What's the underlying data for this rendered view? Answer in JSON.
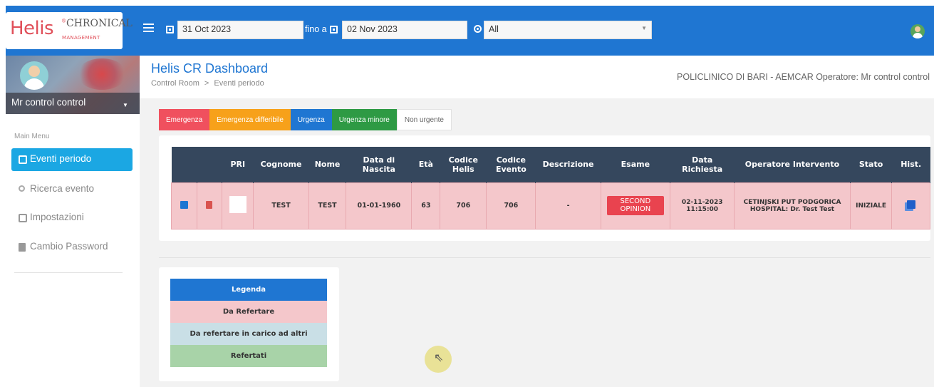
{
  "logo": {
    "helis": "Helis",
    "reg": "®",
    "chronical": "CHRONICAL",
    "management": "MANAGEMENT"
  },
  "topbar": {
    "date_from": "31 Oct 2023",
    "date_to_label": "fino a",
    "date_to": "02 Nov 2023",
    "filter_value": "All"
  },
  "sidebar": {
    "user_name": "Mr control control",
    "menu_label": "Main Menu",
    "items": [
      {
        "label": "Eventi periodo",
        "icon": "calendar-icon",
        "active": true
      },
      {
        "label": "Ricerca evento",
        "icon": "search-icon",
        "active": false
      },
      {
        "label": "Impostazioni",
        "icon": "settings-icon",
        "active": false
      },
      {
        "label": "Cambio Password",
        "icon": "document-icon",
        "active": false
      }
    ]
  },
  "header": {
    "title": "Helis CR Dashboard",
    "breadcrumb_root": "Control Room",
    "breadcrumb_sep": ">",
    "breadcrumb_current": "Eventi periodo",
    "operator_info": "POLICLINICO DI BARI - AEMCAR Operatore: Mr control control"
  },
  "priority_tabs": [
    {
      "label": "Emergenza",
      "bg": "#f0505e",
      "color": "#ffffff"
    },
    {
      "label": "Emergenza differibile",
      "bg": "#f7a11a",
      "color": "#ffffff"
    },
    {
      "label": "Urgenza",
      "bg": "#1f76d2",
      "color": "#ffffff"
    },
    {
      "label": "Urgenza minore",
      "bg": "#2e9a44",
      "color": "#ffffff"
    },
    {
      "label": "Non urgente",
      "bg": "#ffffff",
      "color": "#666666"
    }
  ],
  "table": {
    "headers": [
      "",
      "",
      "PRI",
      "Cognome",
      "Nome",
      "Data di Nascita",
      "Età",
      "Codice Helis",
      "Codice Evento",
      "Descrizione",
      "Esame",
      "Data Richiesta",
      "Operatore Intervento",
      "Stato",
      "Hist."
    ],
    "row": {
      "cognome": "TEST",
      "nome": "TEST",
      "data_nascita": "01-01-1960",
      "eta": "63",
      "codice_helis": "706",
      "codice_evento": "706",
      "descrizione": "-",
      "esame": "SECOND OPINION",
      "data_richiesta": "02-11-2023 11:15:00",
      "operatore_intervento": "CETINJSKI PUT PODGORICA HOSPITAL: Dr. Test Test",
      "stato": "INIZIALE"
    }
  },
  "legend": [
    {
      "label": "Legenda",
      "bg": "#1f76d2",
      "color": "#ffffff"
    },
    {
      "label": "Da Refertare",
      "bg": "#f4c7cb",
      "color": "#333333"
    },
    {
      "label": "Da refertare in carico ad altri",
      "bg": "#c9dfe6",
      "color": "#333333"
    },
    {
      "label": "Refertati",
      "bg": "#a8d3a8",
      "color": "#333333"
    }
  ]
}
